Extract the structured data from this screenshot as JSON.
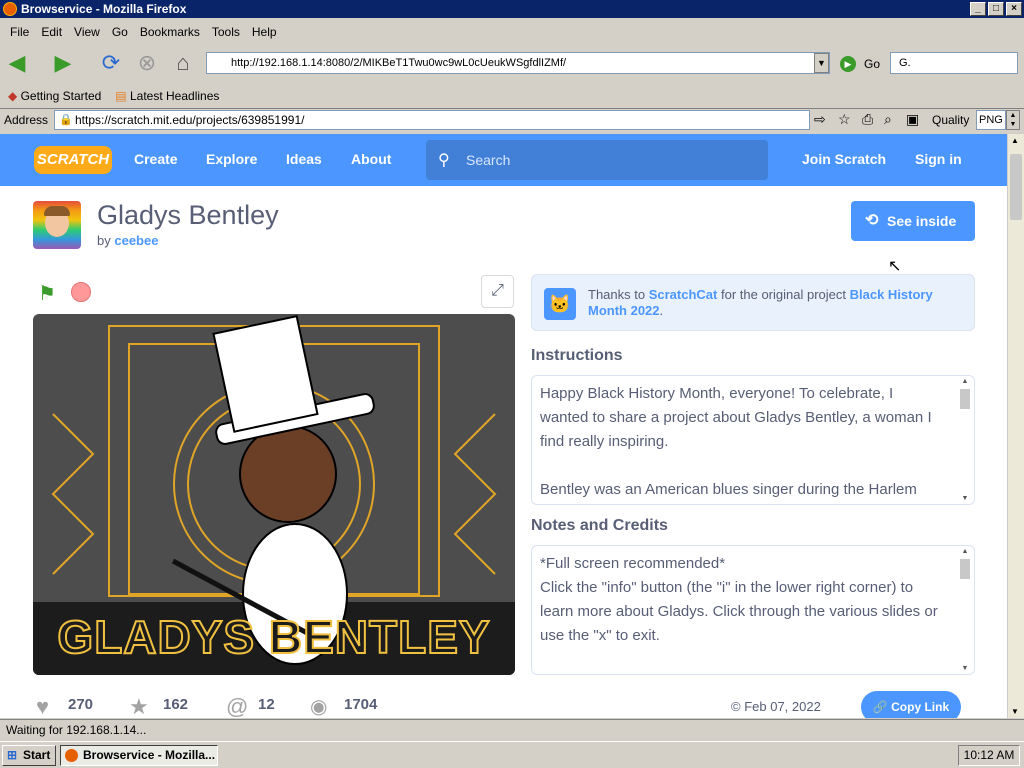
{
  "window": {
    "title": "Browservice - Mozilla Firefox",
    "min": "_",
    "max": "□",
    "close": "×"
  },
  "menu": [
    "File",
    "Edit",
    "View",
    "Go",
    "Bookmarks",
    "Tools",
    "Help"
  ],
  "navbar": {
    "url": "http://192.168.1.14:8080/2/MIKBeT1Twu0wc9wL0cUeukWSgfdlIZMf/",
    "go_label": "Go",
    "search_value": "G."
  },
  "bookmarks": [
    {
      "label": "Getting Started"
    },
    {
      "label": "Latest Headlines"
    }
  ],
  "addressbar": {
    "label": "Address",
    "url": "https://scratch.mit.edu/projects/639851991/",
    "quality_label": "Quality",
    "quality_value": "PNG"
  },
  "scratch": {
    "logo": "SCRATCH",
    "nav": [
      "Create",
      "Explore",
      "Ideas",
      "About"
    ],
    "search_placeholder": "Search",
    "join": "Join Scratch",
    "signin": "Sign in",
    "project": {
      "title": "Gladys Bentley",
      "by": "by",
      "author": "ceebee",
      "see_inside": "See inside"
    },
    "remix": {
      "prefix": "Thanks to",
      "user": "ScratchCat",
      "middle": "for the original project",
      "project": "Black History Month 2022",
      "suffix": "."
    },
    "instructions": {
      "heading": "Instructions",
      "text": "Happy Black History Month, everyone! To celebrate, I wanted to share a project about Gladys Bentley, a woman I find really inspiring.\n\nBentley was an American blues singer during the Harlem"
    },
    "notes": {
      "heading": "Notes and Credits",
      "text": "*Full screen recommended*\nClick the \"info\" button (the \"i\" in the lower right corner) to learn more about Gladys. Click through the various slides or use the \"x\" to exit."
    },
    "stage_banner": "GLADYS BENTLEY",
    "stats": {
      "loves": "270",
      "favorites": "162",
      "remixes": "12",
      "views": "1704"
    },
    "date": "Feb 07, 2022",
    "copy_link": "Copy Link"
  },
  "status": "Waiting for 192.168.1.14...",
  "taskbar": {
    "start": "Start",
    "task": "Browservice - Mozilla...",
    "clock": "10:12 AM"
  },
  "colors": {
    "scratch_blue": "#4c97ff",
    "title_blue": "#0a246a",
    "text_gray": "#575e75"
  }
}
